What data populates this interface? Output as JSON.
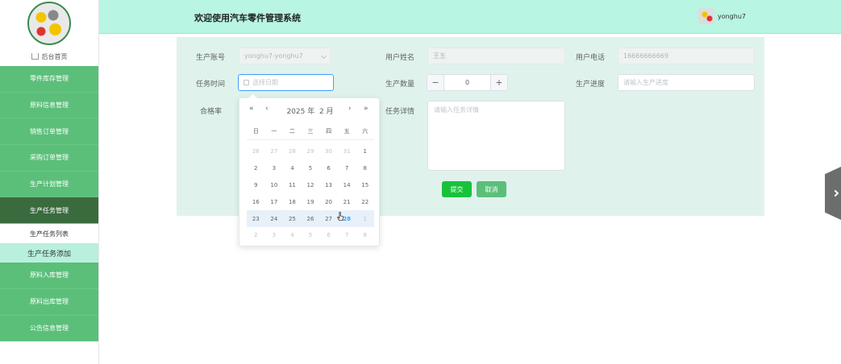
{
  "header": {
    "title": "欢迎使用汽车零件管理系统",
    "username": "yonghu7"
  },
  "sidebar": {
    "home": "后台首页",
    "items": [
      {
        "label": "零件库存管理"
      },
      {
        "label": "原料信息管理"
      },
      {
        "label": "销售订单管理"
      },
      {
        "label": "采购订单管理"
      },
      {
        "label": "生产计划管理"
      },
      {
        "label": "生产任务管理"
      },
      {
        "label": "生产任务列表"
      },
      {
        "label": "生产任务添加"
      },
      {
        "label": "原料入库管理"
      },
      {
        "label": "原料出库管理"
      },
      {
        "label": "公告信息管理"
      }
    ]
  },
  "form": {
    "account_label": "生产账号",
    "account_value": "yonghu7-yonghu7",
    "name_label": "用户姓名",
    "name_value": "王五",
    "phone_label": "用户电话",
    "phone_value": "16666666669",
    "task_time_label": "任务时间",
    "task_time_placeholder": "选择日期",
    "quantity_label": "生产数量",
    "quantity_value": "0",
    "progress_label": "生产进度",
    "progress_placeholder": "请输入生产进度",
    "pass_rate_label": "合格率",
    "details_label": "任务详情",
    "details_placeholder": "请输入任务详情",
    "submit_label": "提交",
    "cancel_label": "取消"
  },
  "datepicker": {
    "year": "2025 年",
    "month": "2 月",
    "weekdays": [
      "日",
      "一",
      "二",
      "三",
      "四",
      "五",
      "六"
    ],
    "days": [
      "26",
      "27",
      "28",
      "29",
      "30",
      "31",
      "1",
      "2",
      "3",
      "4",
      "5",
      "6",
      "7",
      "8",
      "9",
      "10",
      "11",
      "12",
      "13",
      "14",
      "15",
      "16",
      "17",
      "18",
      "19",
      "20",
      "21",
      "22",
      "23",
      "24",
      "25",
      "26",
      "27",
      "28",
      "1",
      "2",
      "3",
      "4",
      "5",
      "6",
      "7",
      "8"
    ],
    "today": "28"
  }
}
